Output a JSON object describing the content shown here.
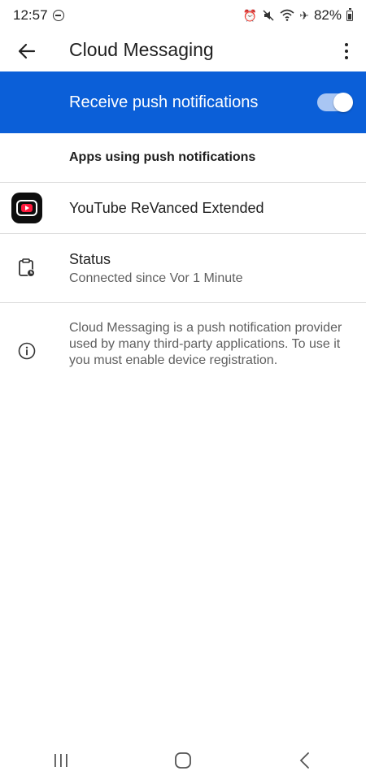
{
  "status_bar": {
    "time": "12:57",
    "battery": "82%"
  },
  "app_bar": {
    "title": "Cloud Messaging"
  },
  "master_switch": {
    "label": "Receive push notifications",
    "enabled": true
  },
  "section": {
    "title": "Apps using push notifications"
  },
  "apps": [
    {
      "name": "YouTube ReVanced Extended"
    }
  ],
  "status": {
    "title": "Status",
    "detail": "Connected since Vor 1 Minute"
  },
  "info": {
    "text": "Cloud Messaging is a push notification provider used by many third-party applications. To use it you must enable device registration."
  },
  "colors": {
    "accent": "#0b5fd8",
    "toggle_track": "#a9c6f3",
    "secondary_text": "#5f5f5f"
  }
}
